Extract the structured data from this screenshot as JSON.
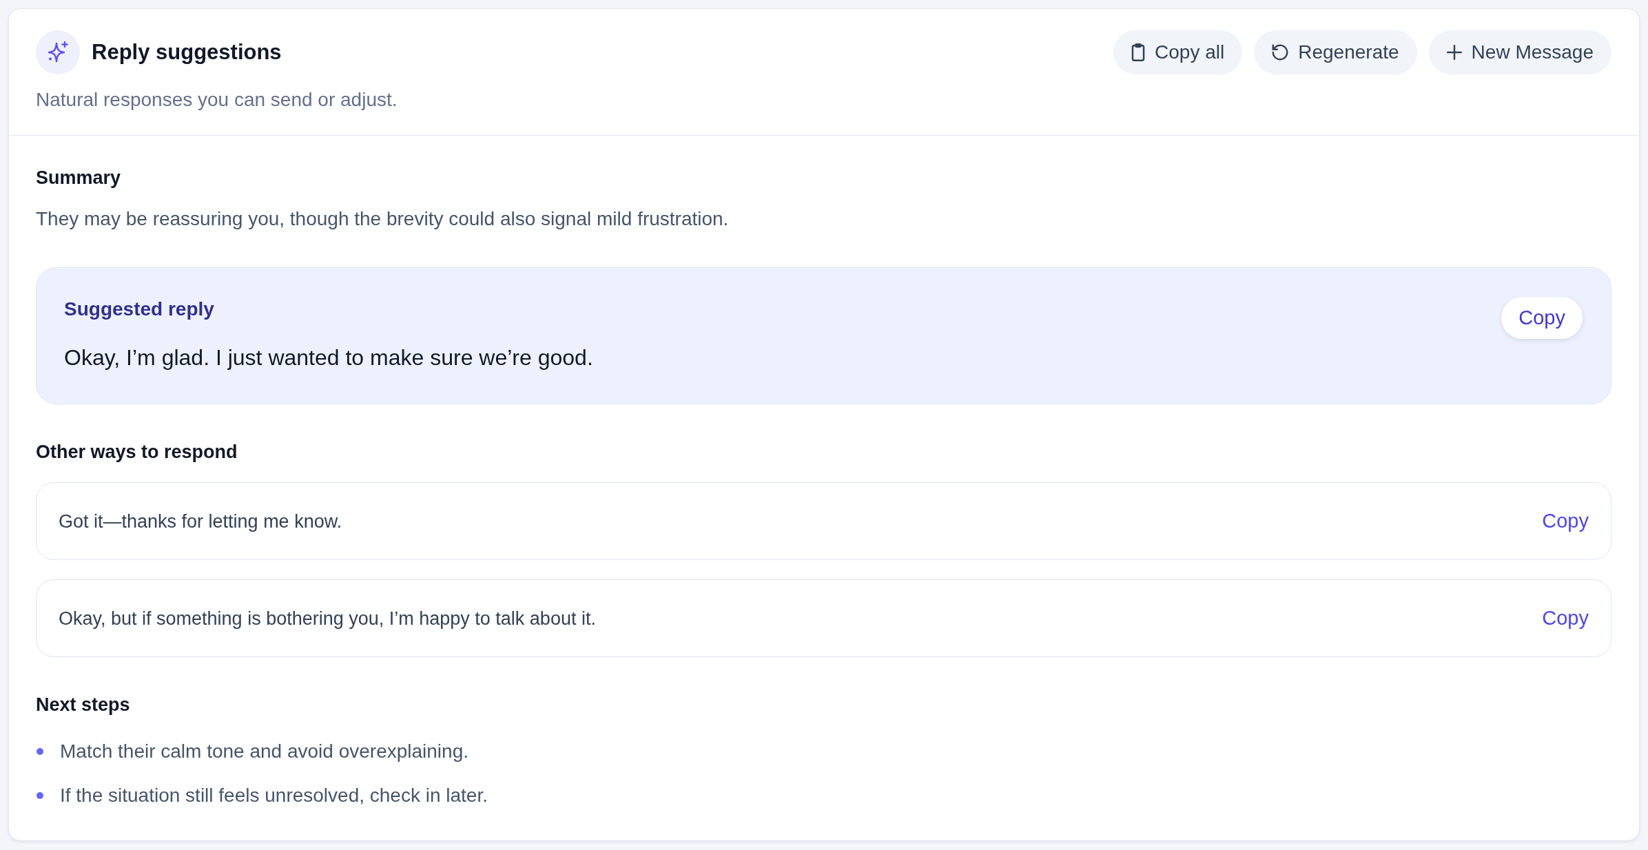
{
  "header": {
    "title": "Reply suggestions",
    "subtitle": "Natural responses you can send or adjust.",
    "actions": [
      {
        "kind": "copy_all",
        "label": "Copy all"
      },
      {
        "kind": "regenerate",
        "label": "Regenerate"
      },
      {
        "kind": "new",
        "label": "New Message"
      }
    ]
  },
  "summary": {
    "heading": "Summary",
    "text": "They may be reassuring you, though the brevity could also signal mild frustration."
  },
  "suggested_reply": {
    "label": "Suggested reply",
    "text": "Okay, I’m glad. I just wanted to make sure we’re good.",
    "copy_label": "Copy"
  },
  "alternatives": {
    "heading": "Other ways to respond",
    "items": [
      {
        "text": "Got it—thanks for letting me know.",
        "copy_label": "Copy"
      },
      {
        "text": "Okay, but if something is bothering you, I’m happy to talk about it.",
        "copy_label": "Copy"
      }
    ]
  },
  "next_steps": {
    "heading": "Next steps",
    "items": [
      "Match their calm tone and avoid overexplaining.",
      "If the situation still feels unresolved, check in later."
    ]
  }
}
